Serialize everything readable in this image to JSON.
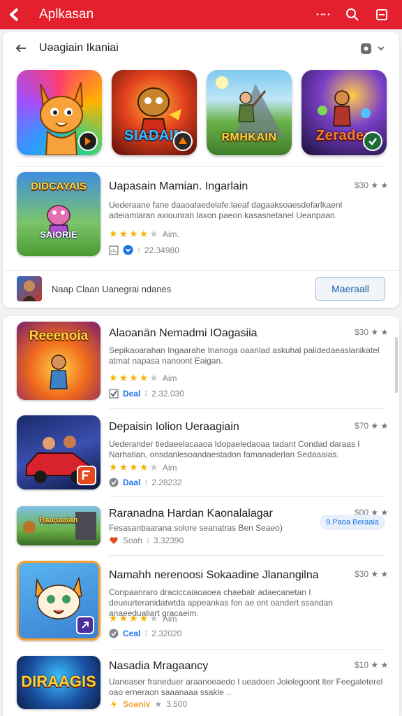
{
  "appbar": {
    "title": "Aplkasan",
    "more_label": "• •• •"
  },
  "section": {
    "title": "Uəagiain Ikaniai"
  },
  "featured": [
    {
      "label": "",
      "theme": "fox"
    },
    {
      "label": "SIADAIN",
      "theme": "fire"
    },
    {
      "label": "RMHKAIN",
      "theme": "field"
    },
    {
      "label": "Zeradea",
      "theme": "space"
    }
  ],
  "top_app": {
    "icon_label_top": "DIDCAYAIS",
    "icon_label_bottom": "SAIORIE",
    "title": "Uapasain Mamian. Ingarlain",
    "price": "$30 ★ ★",
    "desc": "Uederaane fane daaoalaedelafe:laeaf dagaaksoaesdefarlkaenl adeiamlaran axiounran laxon paeon kasasnetanel Ueanpaan.",
    "stars": 4,
    "stars_label": "Aim.",
    "meta_num": "22.34980"
  },
  "banner": {
    "text": "Naap Claan Uanegrai ndanes",
    "button": "Maeraall"
  },
  "apps": [
    {
      "icon_label": "Reeenoia",
      "title": "Alaoanän Nemadmi IOagasiia",
      "price": "$30 ★ ★",
      "desc": "Sepikaoarahan Ingaarahe Inanoga oaanlad askuhal palidedaeaslanikatel atmat napasa nanoont Eaigan.",
      "stars": 4,
      "stars_label": "Aim",
      "tag": "Deal",
      "meta_num": "2.32.030"
    },
    {
      "icon_label": "",
      "title": "Depaisin Iolion Ueraagiain",
      "price": "$70 ★ ★",
      "desc": "Uederander tiedaeelacaaoa Idopaeledaoaa tadant Condad daraas I Narhatian, onsdanlesoandaestadon famanaderlan Sedaaaias.",
      "stars": 4,
      "stars_label": "Aim",
      "tag": "Daal",
      "meta_num": "2.28232"
    },
    {
      "icon_label": "Raanaaian",
      "title": "Raranadna Hardan Kaonalalagar",
      "price": "$00 ★ ★",
      "desc": "Fesasanbaarana solore seanatras Ben Seaeo)",
      "chip": "9.Paoa Beraaia",
      "tag": "Soah",
      "meta_num": "3.32390"
    },
    {
      "icon_label": "",
      "title": "Namahh nerenoosi Sokaadine Jlanangilna",
      "price": "$30 ★ ★",
      "desc": "Conpaanraro draciccaiaoaoea chaebalr adaecanetan I deueurteranidatwtda appeankas fon ae ont oandert ssandan anaeedualiart gracaeim.",
      "stars": 4,
      "stars_label": "Aim",
      "tag": "Ceal",
      "meta_num": "2.32020"
    },
    {
      "icon_label": "DIRAAGIS",
      "title": "Nasadia Mragaancy",
      "price": "$10 ★ ★",
      "desc": "Uaneaser franeduer araanoeaedo I ueadoen Joielegoont lter Feegaleterel oao erneraon saaanaaa ssakle ..",
      "tag": "Soaniv",
      "meta_num": "3.500"
    }
  ],
  "colors": {
    "brand": "#e5202e",
    "star": "#f5b301",
    "link": "#1a73e8"
  }
}
